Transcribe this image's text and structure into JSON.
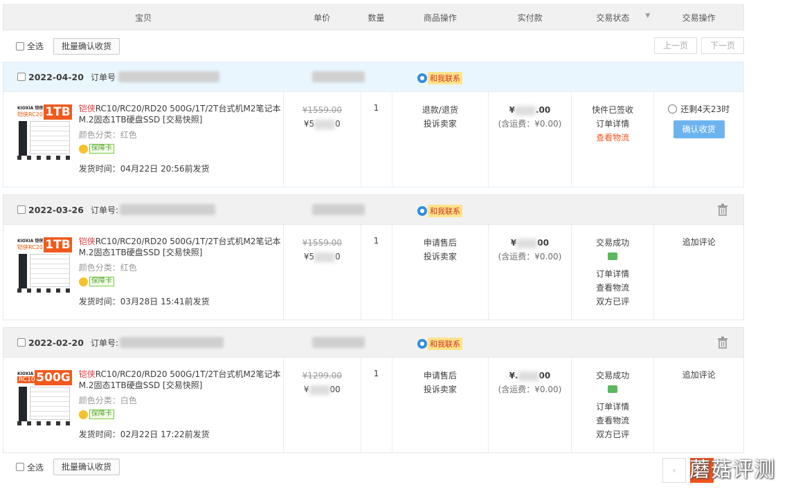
{
  "header": {
    "item": "宝贝",
    "price": "单价",
    "qty": "数量",
    "goods_op": "商品操作",
    "paid": "实付款",
    "status": "交易状态",
    "action": "交易操作"
  },
  "toolbar": {
    "select_all": "全选",
    "batch_confirm": "批量确认收货",
    "prev_page": "上一页",
    "next_page": "下一页"
  },
  "contact_label": "和我联系",
  "orders": [
    {
      "date": "2022-04-20",
      "order_no_label": "订单号",
      "title_hl": "铠侠",
      "title": "RC10/RC20/RD20 500G/1T/2T台式机M2笔记本M.2固态1TB硬盘SSD [交易快照]",
      "color": "颜色分类：红色",
      "guarantee": "保障卡",
      "ship_time": "发货时间：04月22日 20:56前发货",
      "thumb_brand": "KIOXIA 铠侠",
      "thumb_model": "铠侠RC20",
      "thumb_capacity": "1TB",
      "old_price": "¥1559.00",
      "price": "¥5",
      "price_suffix": "0",
      "qty": "1",
      "ops": [
        "退款/退货",
        "投诉卖家"
      ],
      "paid": "¥",
      "paid_suffix": ".00",
      "shipping": "(含运费：¥0.00)",
      "status": [
        "快件已签收",
        "订单详情",
        "查看物流"
      ],
      "remain": "还剩4天23时",
      "confirm": "确认收货"
    },
    {
      "date": "2022-03-26",
      "order_no_label": "订单号:",
      "title_hl": "铠侠",
      "title": "RC10/RC20/RD20 500G/1T/2T台式机M2笔记本M.2固态1TB硬盘SSD [交易快照]",
      "color": "颜色分类：红色",
      "guarantee": "保障卡",
      "ship_time": "发货时间：03月28日 15:41前发货",
      "thumb_brand": "KIOXIA 铠侠",
      "thumb_model": "铠侠RC20",
      "thumb_capacity": "1TB",
      "old_price": "¥1559.00",
      "price": "¥5",
      "price_suffix": "0",
      "qty": "1",
      "ops": [
        "申请售后",
        "投诉卖家"
      ],
      "paid": "¥",
      "paid_suffix": "00",
      "shipping": "(含运费：¥0.00)",
      "status_top": "交易成功",
      "status_rest": [
        "订单详情",
        "查看物流",
        "双方已评"
      ],
      "action": "追加评论"
    },
    {
      "date": "2022-02-20",
      "order_no_label": "订单号:",
      "title_hl": "铠侠",
      "title": "RC10/RC20/RD20 500G/1T/2T台式机M2笔记本M.2固态1TB硬盘SSD [交易快照]",
      "color": "颜色分类：白色",
      "guarantee": "保障卡",
      "ship_time": "发货时间：02月22日 17:22前发货",
      "thumb_brand": "KIOXIA 铠侠",
      "thumb_model": "RC10",
      "thumb_capacity": "500G",
      "old_price": "¥1299.00",
      "price": "¥",
      "price_suffix": "00",
      "qty": "1",
      "ops": [
        "申请售后",
        "投诉卖家"
      ],
      "paid": "¥.",
      "paid_suffix": "00",
      "shipping": "(含运费：¥0.00)",
      "status_top": "交易成功",
      "status_rest": [
        "订单详情",
        "查看物流",
        "双方已评"
      ],
      "action": "追加评论"
    }
  ],
  "footer": {
    "select_all": "全选",
    "batch_confirm": "批量确认收货",
    "prev_arrow": "‹"
  },
  "watermark": "蘑菇评测",
  "colors": {
    "accent_orange": "#f0541e",
    "confirm_blue": "#6db4ee",
    "header_bg": "#f1f1f1",
    "pending_order_bg": "#eaf6fd"
  }
}
